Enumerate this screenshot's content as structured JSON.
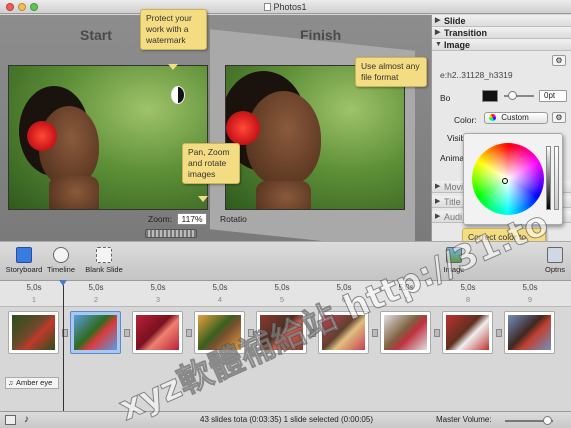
{
  "window": {
    "title": "Photos1",
    "traffic": [
      "#ee5c53",
      "#f5bd4f",
      "#61c454"
    ]
  },
  "stage": {
    "start_label": "Start",
    "finish_label": "Finish",
    "zoom_label": "Zoom:",
    "zoom_value": "117%",
    "rotation_label": "Rotatio",
    "tips": {
      "watermark": "Protect your work with a watermark",
      "file_format": "Use almost any file format",
      "pan_zoom": "Pan, Zoom and rotate images",
      "correct_color": "Correct color to make successive slides match"
    }
  },
  "panel": {
    "sections": {
      "slide": "Slide",
      "transition": "Transition",
      "image": "Image",
      "movie": "Movi",
      "title": "Title",
      "audio": "Audi"
    },
    "file_name": "e:h2..31128_h3319",
    "bg_label": "Bo",
    "bg_value": "0pt",
    "color_label": "Color:",
    "color_value": "Custom",
    "visible_label": "Visib",
    "anim_label": "Anima",
    "gear_icon": "gear-icon"
  },
  "toolbar": {
    "storyboard": "Storyboard",
    "timeline": "Timeline",
    "blank_slide": "Blank Slide",
    "images": "Image",
    "options": "Optns"
  },
  "timeline": {
    "durations": [
      "5,0s",
      "5,0s",
      "5,0s",
      "5,0s",
      "5,0s",
      "5,0s",
      "5,0s",
      "5,0s",
      "5,0s"
    ],
    "numbers": [
      "1",
      "2",
      "3",
      "4",
      "5",
      "6",
      "7",
      "8",
      "9"
    ],
    "audio_track": "Amber eye"
  },
  "status": {
    "summary": "43 slides tota (0:03:35) 1 slide selected (0:00:05)",
    "master_volume": "Master Volume:"
  },
  "overlay_text": "xyz軟體補給站 http://31.to"
}
